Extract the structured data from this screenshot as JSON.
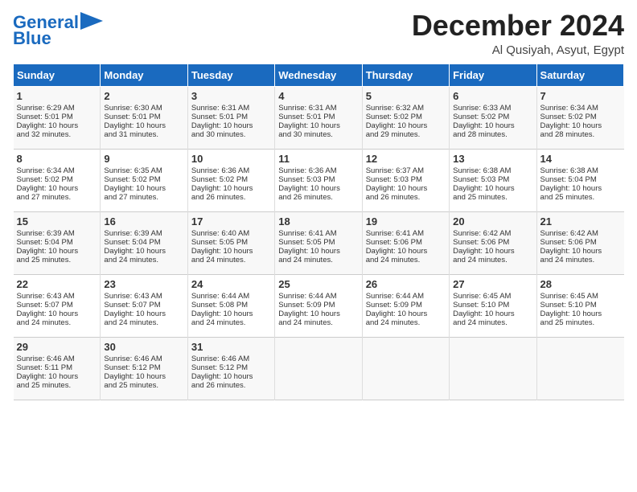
{
  "header": {
    "logo_line1": "General",
    "logo_line2": "Blue",
    "month": "December 2024",
    "location": "Al Qusiyah, Asyut, Egypt"
  },
  "days_of_week": [
    "Sunday",
    "Monday",
    "Tuesday",
    "Wednesday",
    "Thursday",
    "Friday",
    "Saturday"
  ],
  "weeks": [
    [
      {
        "day": "1",
        "info": "Sunrise: 6:29 AM\nSunset: 5:01 PM\nDaylight: 10 hours\nand 32 minutes."
      },
      {
        "day": "2",
        "info": "Sunrise: 6:30 AM\nSunset: 5:01 PM\nDaylight: 10 hours\nand 31 minutes."
      },
      {
        "day": "3",
        "info": "Sunrise: 6:31 AM\nSunset: 5:01 PM\nDaylight: 10 hours\nand 30 minutes."
      },
      {
        "day": "4",
        "info": "Sunrise: 6:31 AM\nSunset: 5:01 PM\nDaylight: 10 hours\nand 30 minutes."
      },
      {
        "day": "5",
        "info": "Sunrise: 6:32 AM\nSunset: 5:02 PM\nDaylight: 10 hours\nand 29 minutes."
      },
      {
        "day": "6",
        "info": "Sunrise: 6:33 AM\nSunset: 5:02 PM\nDaylight: 10 hours\nand 28 minutes."
      },
      {
        "day": "7",
        "info": "Sunrise: 6:34 AM\nSunset: 5:02 PM\nDaylight: 10 hours\nand 28 minutes."
      }
    ],
    [
      {
        "day": "8",
        "info": "Sunrise: 6:34 AM\nSunset: 5:02 PM\nDaylight: 10 hours\nand 27 minutes."
      },
      {
        "day": "9",
        "info": "Sunrise: 6:35 AM\nSunset: 5:02 PM\nDaylight: 10 hours\nand 27 minutes."
      },
      {
        "day": "10",
        "info": "Sunrise: 6:36 AM\nSunset: 5:02 PM\nDaylight: 10 hours\nand 26 minutes."
      },
      {
        "day": "11",
        "info": "Sunrise: 6:36 AM\nSunset: 5:03 PM\nDaylight: 10 hours\nand 26 minutes."
      },
      {
        "day": "12",
        "info": "Sunrise: 6:37 AM\nSunset: 5:03 PM\nDaylight: 10 hours\nand 26 minutes."
      },
      {
        "day": "13",
        "info": "Sunrise: 6:38 AM\nSunset: 5:03 PM\nDaylight: 10 hours\nand 25 minutes."
      },
      {
        "day": "14",
        "info": "Sunrise: 6:38 AM\nSunset: 5:04 PM\nDaylight: 10 hours\nand 25 minutes."
      }
    ],
    [
      {
        "day": "15",
        "info": "Sunrise: 6:39 AM\nSunset: 5:04 PM\nDaylight: 10 hours\nand 25 minutes."
      },
      {
        "day": "16",
        "info": "Sunrise: 6:39 AM\nSunset: 5:04 PM\nDaylight: 10 hours\nand 24 minutes."
      },
      {
        "day": "17",
        "info": "Sunrise: 6:40 AM\nSunset: 5:05 PM\nDaylight: 10 hours\nand 24 minutes."
      },
      {
        "day": "18",
        "info": "Sunrise: 6:41 AM\nSunset: 5:05 PM\nDaylight: 10 hours\nand 24 minutes."
      },
      {
        "day": "19",
        "info": "Sunrise: 6:41 AM\nSunset: 5:06 PM\nDaylight: 10 hours\nand 24 minutes."
      },
      {
        "day": "20",
        "info": "Sunrise: 6:42 AM\nSunset: 5:06 PM\nDaylight: 10 hours\nand 24 minutes."
      },
      {
        "day": "21",
        "info": "Sunrise: 6:42 AM\nSunset: 5:06 PM\nDaylight: 10 hours\nand 24 minutes."
      }
    ],
    [
      {
        "day": "22",
        "info": "Sunrise: 6:43 AM\nSunset: 5:07 PM\nDaylight: 10 hours\nand 24 minutes."
      },
      {
        "day": "23",
        "info": "Sunrise: 6:43 AM\nSunset: 5:07 PM\nDaylight: 10 hours\nand 24 minutes."
      },
      {
        "day": "24",
        "info": "Sunrise: 6:44 AM\nSunset: 5:08 PM\nDaylight: 10 hours\nand 24 minutes."
      },
      {
        "day": "25",
        "info": "Sunrise: 6:44 AM\nSunset: 5:09 PM\nDaylight: 10 hours\nand 24 minutes."
      },
      {
        "day": "26",
        "info": "Sunrise: 6:44 AM\nSunset: 5:09 PM\nDaylight: 10 hours\nand 24 minutes."
      },
      {
        "day": "27",
        "info": "Sunrise: 6:45 AM\nSunset: 5:10 PM\nDaylight: 10 hours\nand 24 minutes."
      },
      {
        "day": "28",
        "info": "Sunrise: 6:45 AM\nSunset: 5:10 PM\nDaylight: 10 hours\nand 25 minutes."
      }
    ],
    [
      {
        "day": "29",
        "info": "Sunrise: 6:46 AM\nSunset: 5:11 PM\nDaylight: 10 hours\nand 25 minutes."
      },
      {
        "day": "30",
        "info": "Sunrise: 6:46 AM\nSunset: 5:12 PM\nDaylight: 10 hours\nand 25 minutes."
      },
      {
        "day": "31",
        "info": "Sunrise: 6:46 AM\nSunset: 5:12 PM\nDaylight: 10 hours\nand 26 minutes."
      },
      {
        "day": "",
        "info": ""
      },
      {
        "day": "",
        "info": ""
      },
      {
        "day": "",
        "info": ""
      },
      {
        "day": "",
        "info": ""
      }
    ]
  ]
}
